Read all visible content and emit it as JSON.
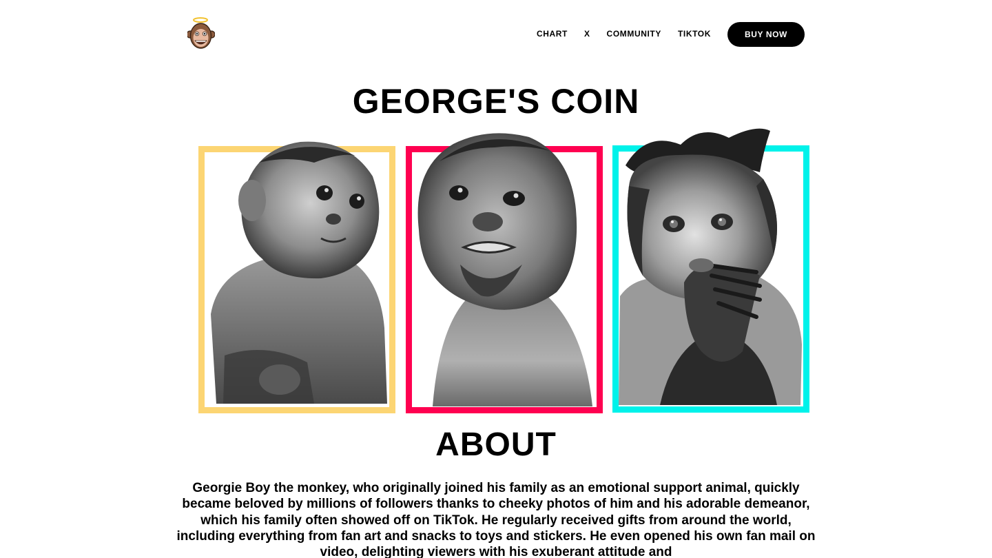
{
  "header": {
    "logo_icon": "angel-monkey-logo-icon",
    "nav": {
      "chart": "CHART",
      "x": "X",
      "community": "COMMUNITY",
      "tiktok": "TIKTOK",
      "buy_now": "BUY NOW"
    }
  },
  "hero": {
    "title": "GEORGE'S COIN",
    "frame_colors": [
      "#FCD573",
      "#FF0050",
      "#00F2EA"
    ],
    "photos": [
      "monkey-photo-sitting",
      "monkey-photo-looking-up",
      "monkey-photo-hand-on-mouth"
    ]
  },
  "about": {
    "title": "ABOUT",
    "text": "Georgie Boy the monkey, who originally joined his family as an emotional support animal, quickly became beloved by millions of followers thanks to cheeky photos of him and his adorable demeanor, which his family often showed off on TikTok. He regularly received gifts from around the world, including everything from fan art and snacks to toys and stickers. He even opened his own fan mail on video, delighting viewers with his exuberant attitude and"
  }
}
